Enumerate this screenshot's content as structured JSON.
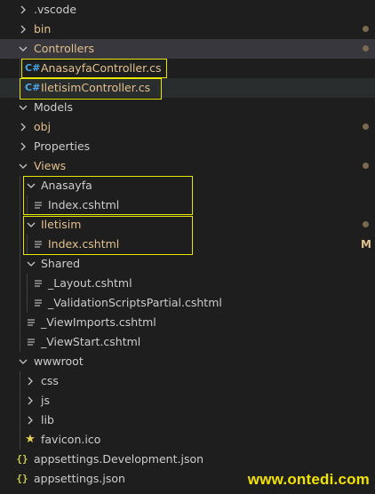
{
  "explorer": {
    "rows": [
      {
        "label": ".vscode",
        "kind": "folder-collapsed"
      },
      {
        "label": "bin",
        "kind": "folder-collapsed",
        "decoration": "dot"
      },
      {
        "label": "Controllers",
        "kind": "folder-open",
        "decoration": "dot"
      },
      {
        "label": "AnasayfaController.cs",
        "kind": "cs-file"
      },
      {
        "label": "IletisimController.cs",
        "kind": "cs-file"
      },
      {
        "label": "Models",
        "kind": "folder-open"
      },
      {
        "label": "obj",
        "kind": "folder-collapsed",
        "decoration": "dot"
      },
      {
        "label": "Properties",
        "kind": "folder-collapsed"
      },
      {
        "label": "Views",
        "kind": "folder-open",
        "decoration": "dot"
      },
      {
        "label": "Anasayfa",
        "kind": "folder-open"
      },
      {
        "label": "Index.cshtml",
        "kind": "cshtml-file"
      },
      {
        "label": "Iletisim",
        "kind": "folder-open",
        "decoration": "dot"
      },
      {
        "label": "Index.cshtml",
        "kind": "cshtml-file",
        "git_status": "M"
      },
      {
        "label": "Shared",
        "kind": "folder-open"
      },
      {
        "label": "_Layout.cshtml",
        "kind": "cshtml-file"
      },
      {
        "label": "_ValidationScriptsPartial.cshtml",
        "kind": "cshtml-file"
      },
      {
        "label": "_ViewImports.cshtml",
        "kind": "cshtml-file"
      },
      {
        "label": "_ViewStart.cshtml",
        "kind": "cshtml-file"
      },
      {
        "label": "wwwroot",
        "kind": "folder-open"
      },
      {
        "label": "css",
        "kind": "folder-collapsed"
      },
      {
        "label": "js",
        "kind": "folder-collapsed"
      },
      {
        "label": "lib",
        "kind": "folder-collapsed"
      },
      {
        "label": "favicon.ico",
        "kind": "ico-file"
      },
      {
        "label": "appsettings.Development.json",
        "kind": "json-file"
      },
      {
        "label": "appsettings.json",
        "kind": "json-file"
      }
    ]
  },
  "watermark": "www.ontedi.com",
  "colors": {
    "background": "#1e1e1e",
    "selection": "#37373d",
    "highlight_box": "#e6e600",
    "modified": "#e2c08d",
    "csharp_icon": "#4aa6e8",
    "json_icon": "#cbcb41",
    "watermark": "#f2e200"
  },
  "icons": {
    "chevron-right": "chevron-right-icon",
    "chevron-down": "chevron-down-icon",
    "cs": "csharp-file-icon",
    "cshtml": "razor-file-icon",
    "json": "json-file-icon",
    "ico": "star-icon"
  }
}
